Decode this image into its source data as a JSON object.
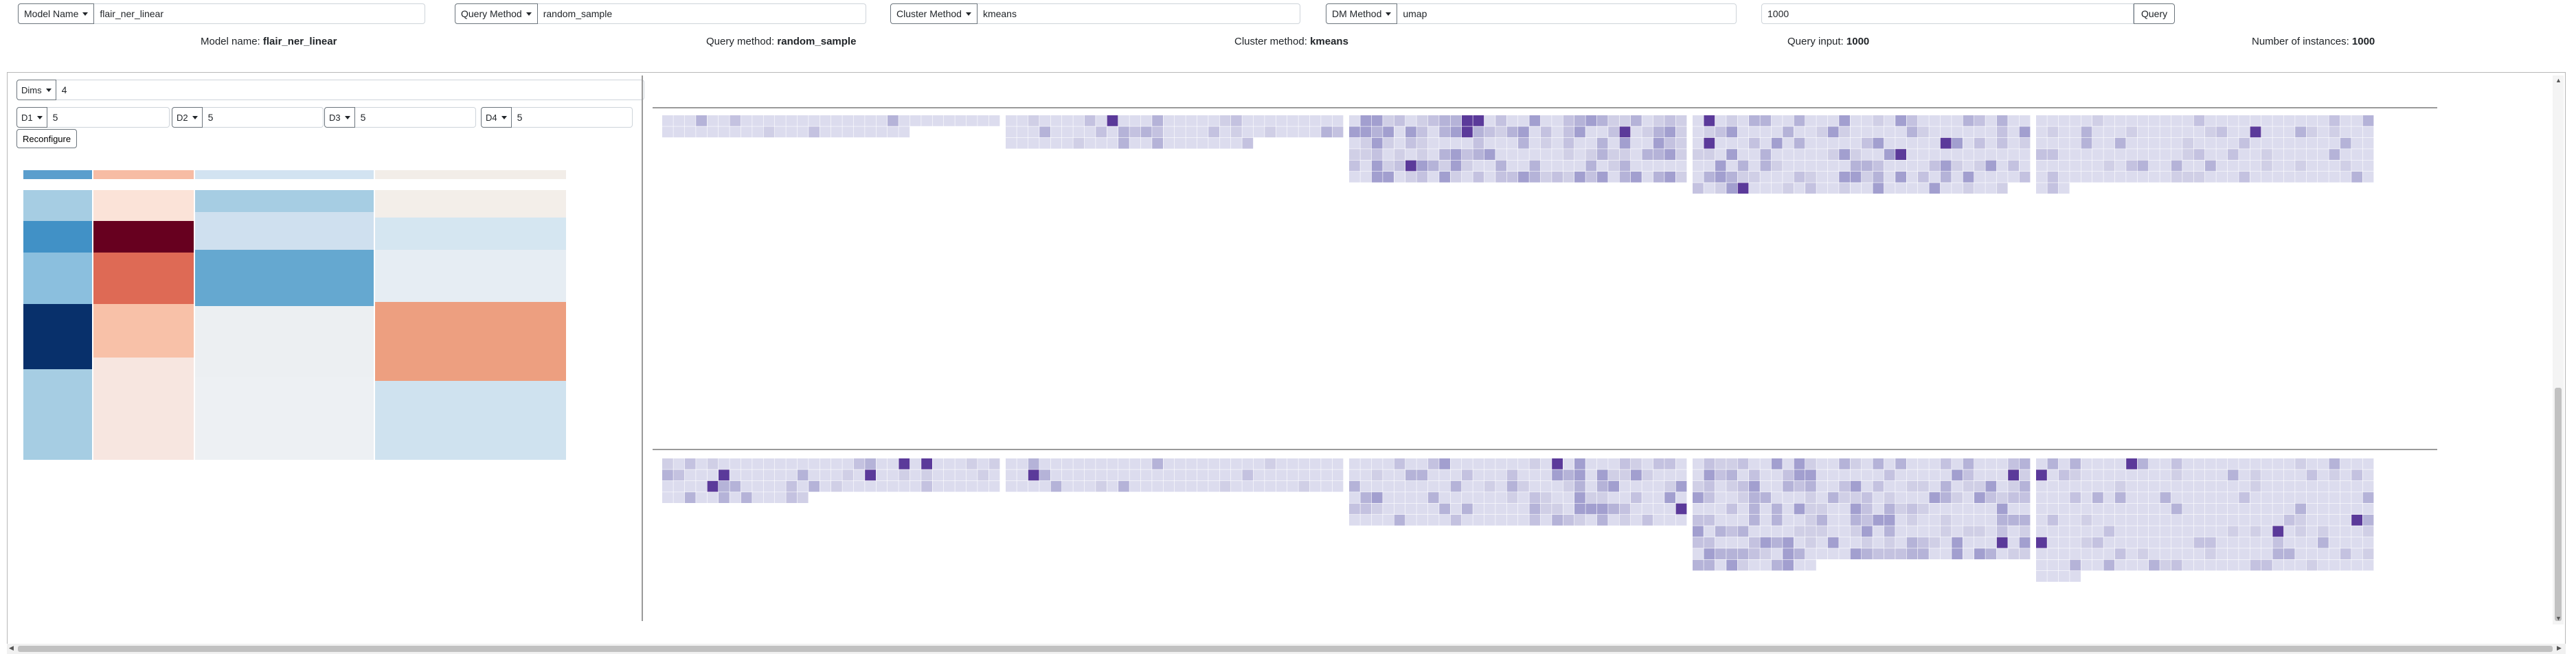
{
  "controls": {
    "model_name": {
      "label": "Model Name",
      "value": "flair_ner_linear"
    },
    "query_method": {
      "label": "Query Method",
      "value": "random_sample"
    },
    "cluster_method": {
      "label": "Cluster Method",
      "value": "kmeans"
    },
    "dm_method": {
      "label": "DM Method",
      "value": "umap"
    },
    "query_input": {
      "value": "1000",
      "button_label": "Query"
    }
  },
  "summary": {
    "model_label": "Model name:",
    "model_value": "flair_ner_linear",
    "qmethod_label": "Query method:",
    "qmethod_value": "random_sample",
    "cmethod_label": "Cluster method:",
    "cmethod_value": "kmeans",
    "qinput_label": "Query input:",
    "qinput_value": "1000",
    "ninst_label": "Number of instances:",
    "ninst_value": "1000"
  },
  "config": {
    "dims": {
      "label": "Dims",
      "value": "4"
    },
    "d": [
      {
        "label": "D1",
        "value": "5"
      },
      {
        "label": "D2",
        "value": "5"
      },
      {
        "label": "D3",
        "value": "5"
      },
      {
        "label": "D4",
        "value": "5"
      }
    ],
    "reconfigure_label": "Reconfigure"
  },
  "colors": {
    "blue_dark": "#08306b",
    "blue_mid": "#4191c6",
    "blue_light": "#a6cde3",
    "red_dark": "#67001f",
    "red_mid": "#de6a55",
    "salmon": "#ef9f80",
    "purple_base": "#dadaeb",
    "purple_dark": "#54278f"
  }
}
